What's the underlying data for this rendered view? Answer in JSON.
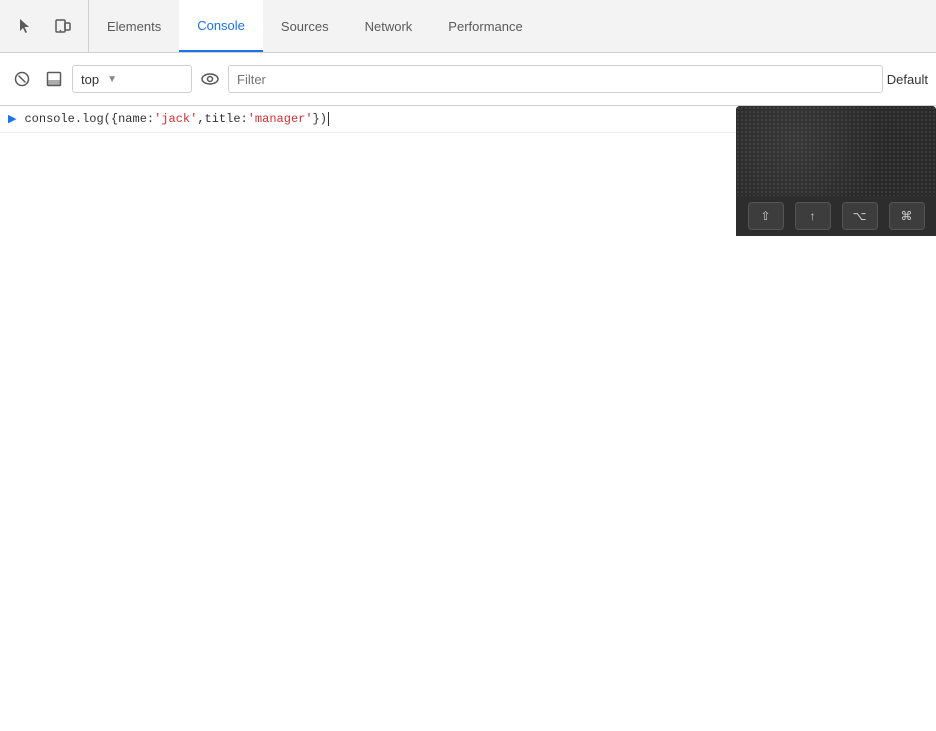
{
  "tabs": [
    {
      "id": "cursor-icon",
      "type": "icon"
    },
    {
      "id": "inspector-icon",
      "type": "icon"
    },
    {
      "label": "Elements",
      "active": false
    },
    {
      "label": "Console",
      "active": true
    },
    {
      "label": "Sources",
      "active": false
    },
    {
      "label": "Network",
      "active": false
    },
    {
      "label": "Performance",
      "active": false
    }
  ],
  "toolbar": {
    "context_value": "top",
    "filter_placeholder": "Filter",
    "default_label": "Default"
  },
  "console": {
    "line": {
      "prefix": "console.log({name:",
      "value1": "'jack'",
      "separator": ",title:",
      "value2": "'manager'",
      "suffix": "})"
    }
  },
  "keyboard_overlay": {
    "keys": [
      "⇧",
      "↑",
      "⌥",
      "⌘"
    ]
  }
}
